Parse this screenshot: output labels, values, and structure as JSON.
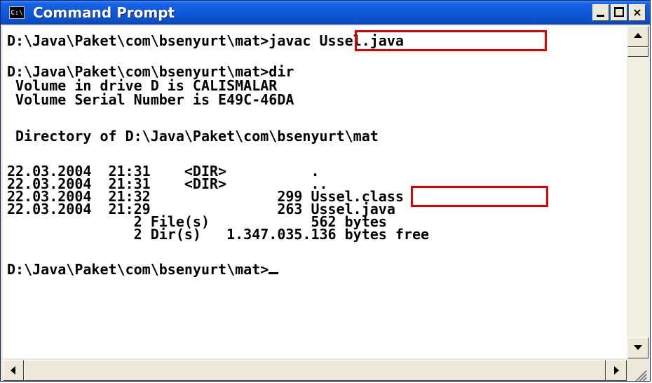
{
  "window": {
    "title": "Command Prompt",
    "icon": "console-icon",
    "icon_label": "C:\\",
    "buttons": [
      "minimize",
      "maximize",
      "close"
    ],
    "close_label": "×"
  },
  "console": {
    "lines": [
      "D:\\Java\\Paket\\com\\bsenyurt\\mat>javac Ussel.java",
      "",
      "D:\\Java\\Paket\\com\\bsenyurt\\mat>dir",
      " Volume in drive D is CALISMALAR",
      " Volume Serial Number is E49C-46DA",
      "",
      " Directory of D:\\Java\\Paket\\com\\bsenyurt\\mat",
      "",
      "22.03.2004  21:31    <DIR>          .",
      "22.03.2004  21:31    <DIR>          ..",
      "22.03.2004  21:32               299 Ussel.class",
      "22.03.2004  21:29               263 Ussel.java",
      "               2 File(s)            562 bytes",
      "               2 Dir(s)   1.347.035.136 bytes free",
      "",
      "D:\\Java\\Paket\\com\\bsenyurt\\mat>"
    ],
    "highlights": [
      "javac Ussel.java",
      "Ussel.class"
    ]
  },
  "colors": {
    "titlebar": "#0b4fc9",
    "console_bg": "#ffffff",
    "console_text": "#000000",
    "highlight": "#e00000"
  }
}
